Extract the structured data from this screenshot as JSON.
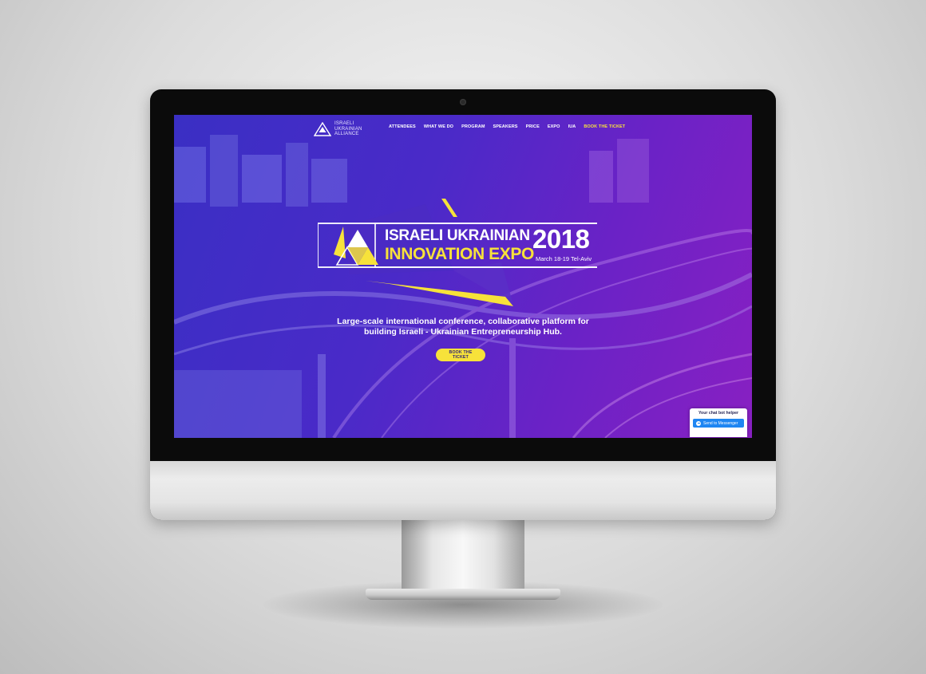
{
  "site": {
    "logo_lines": [
      "ISRAELI",
      "UKRAINIAN",
      "ALLIANCE"
    ],
    "nav": [
      {
        "label": "ATTENDEES"
      },
      {
        "label": "WHAT WE DO"
      },
      {
        "label": "PROGRAM"
      },
      {
        "label": "SPEAKERS"
      },
      {
        "label": "PRICE"
      },
      {
        "label": "EXPO"
      },
      {
        "label": "IUA"
      },
      {
        "label": "BOOK THE TICKET"
      }
    ]
  },
  "hero": {
    "title_line1": "ISRAELI UKRAINIAN",
    "title_line2": "INNOVATION EXPO",
    "year": "2018",
    "date": "March 18-19 Tel-Aviv",
    "tagline_line1": "Large-scale international conference, collaborative platform for",
    "tagline_line2": "building Israeli - Ukrainian Entrepreneurship Hub.",
    "cta_label": "BOOK THE TICKET"
  },
  "chat_widget": {
    "title": "Your chat bot helper",
    "button_label": "Send to Messenger"
  },
  "colors": {
    "accent_yellow": "#f7e23a",
    "bg_blue": "#3a2fc4",
    "bg_purple": "#8820c2",
    "messenger_blue": "#1f86f2"
  }
}
